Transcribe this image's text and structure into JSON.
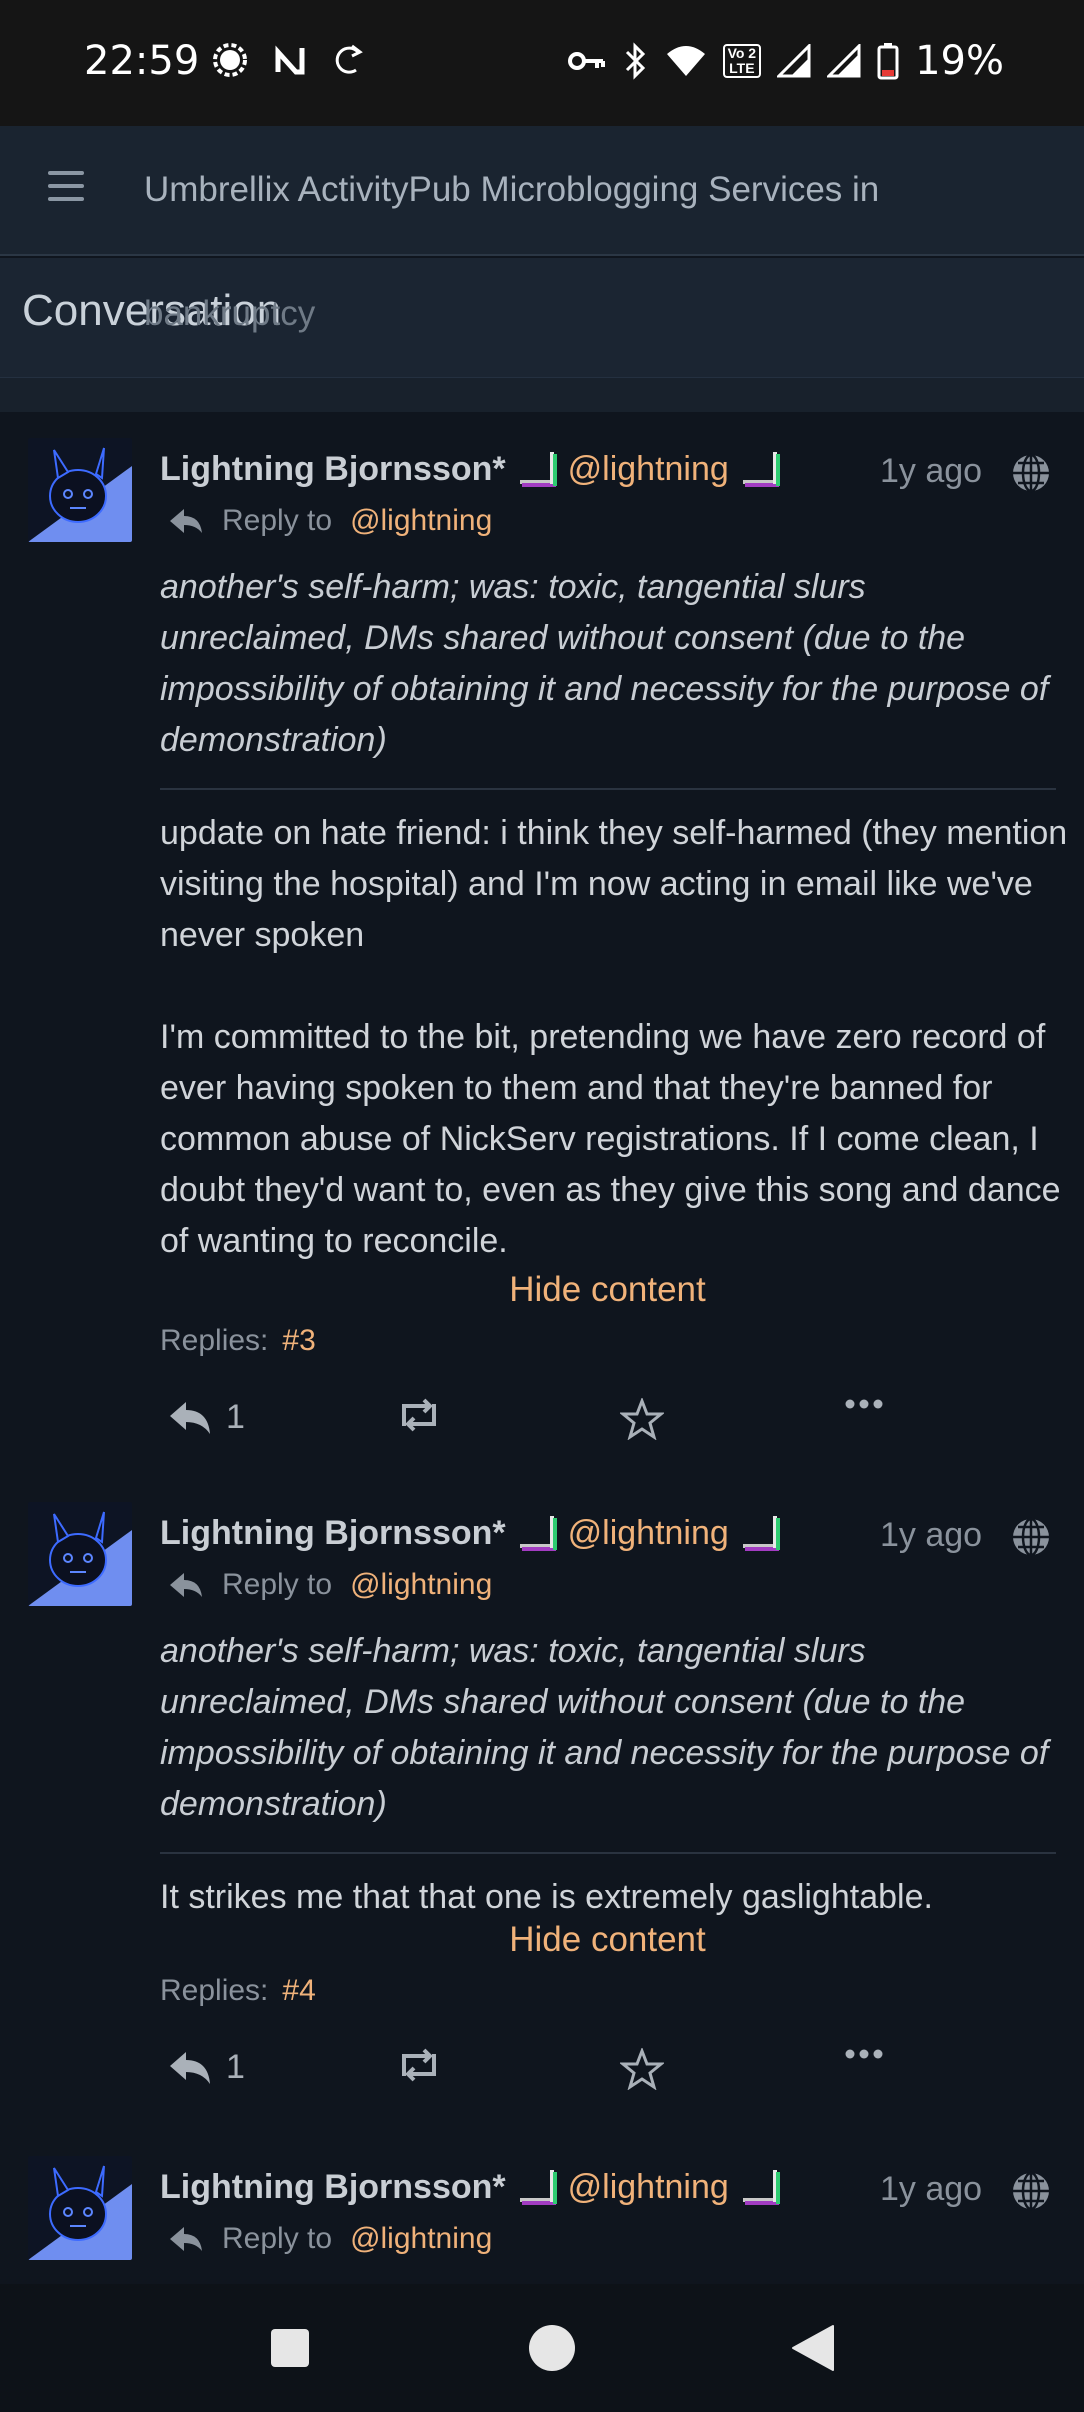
{
  "status_bar": {
    "time": "22:59",
    "battery": "19%",
    "left_icons": [
      "signal-messenger-icon",
      "nfc-icon",
      "sync-icon"
    ],
    "right_icons": [
      "vpn-key-icon",
      "bluetooth-icon",
      "wifi-icon",
      "volte-icon",
      "cell-signal-icon",
      "cell-signal-icon",
      "battery-low-icon"
    ],
    "volte_text_1": "Vo 2",
    "volte_text_2": "LTE"
  },
  "app_bar": {
    "title": "Umbrellix ActivityPub Microblogging Services in",
    "title_wrap": "bankruptcy",
    "menu_icon": "hamburger-menu-icon"
  },
  "sub_bar": {
    "title": "Conversation"
  },
  "posts": [
    {
      "author": "Lightning Bjornsson*",
      "handle": "@lightning",
      "ago": "1y ago",
      "reply_label": "Reply to",
      "reply_handle": "@lightning",
      "content_warning": "another's self-harm; was: toxic, tangential slurs unreclaimed, DMs shared without consent (due to the impossibility of obtaining it and necessity for the purpose of demonstration)",
      "body": "update on hate friend: i think they self-harmed (they mention visiting the hospital) and I'm now acting in email like we've never spoken\n\nI'm committed to the bit, pretending we have zero record of ever having spoken to them and that they're banned for common abuse of NickServ registrations. If I come clean, I doubt they'd want to, even as they give this song and dance of wanting to reconcile.",
      "hide_label": "Hide content",
      "replies_label": "Replies:",
      "replies_value": "#3",
      "reply_count": "1"
    },
    {
      "author": "Lightning Bjornsson*",
      "handle": "@lightning",
      "ago": "1y ago",
      "reply_label": "Reply to",
      "reply_handle": "@lightning",
      "content_warning": "another's self-harm; was: toxic, tangential slurs unreclaimed, DMs shared without consent (due to the impossibility of obtaining it and necessity for the purpose of demonstration)",
      "body": "It strikes me that that one is extremely gaslightable.",
      "hide_label": "Hide content",
      "replies_label": "Replies:",
      "replies_value": "#4",
      "reply_count": "1"
    },
    {
      "author": "Lightning Bjornsson*",
      "handle": "@lightning",
      "ago": "1y ago",
      "reply_label": "Reply to",
      "reply_handle": "@lightning"
    }
  ],
  "colors": {
    "accent": "#f0b27a",
    "background": "#0f151e",
    "header": "#1a2430",
    "avatar_blue": "#6f8ef0"
  }
}
